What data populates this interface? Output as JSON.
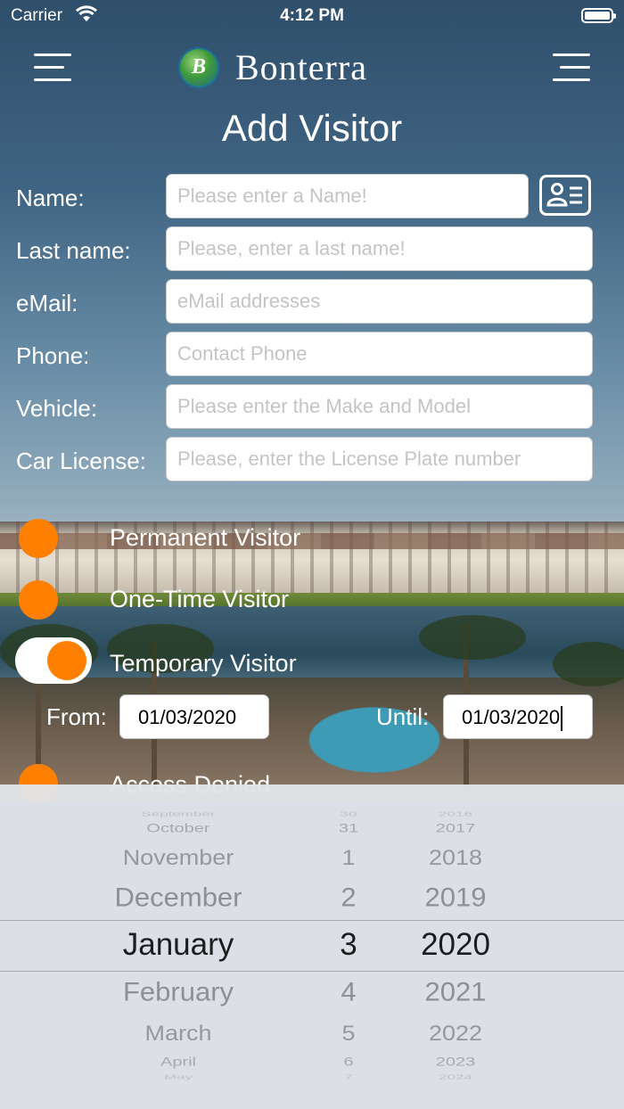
{
  "status_bar": {
    "carrier": "Carrier",
    "time": "4:12 PM"
  },
  "header": {
    "brand": "Bonterra",
    "logo_letter": "B",
    "title": "Add Visitor"
  },
  "form": {
    "fields": [
      {
        "label": "Name:",
        "placeholder": "Please enter a Name!"
      },
      {
        "label": "Last name:",
        "placeholder": "Please, enter a last name!"
      },
      {
        "label": "eMail:",
        "placeholder": "eMail addresses"
      },
      {
        "label": "Phone:",
        "placeholder": "Contact Phone"
      },
      {
        "label": "Vehicle:",
        "placeholder": "Please enter the Make and Model"
      },
      {
        "label": "Car License:",
        "placeholder": "Please, enter the License Plate number"
      }
    ]
  },
  "visitor_types": [
    {
      "label": "Permanent Visitor",
      "selected": false
    },
    {
      "label": "One-Time Visitor",
      "selected": false
    },
    {
      "label": "Temporary Visitor",
      "selected": true
    },
    {
      "label": "Access Denied",
      "selected": false
    }
  ],
  "dates": {
    "from_label": "From:",
    "from_value": "01/03/2020",
    "until_label": "Until:",
    "until_value": "01/03/2020"
  },
  "picker": {
    "months": [
      "September",
      "October",
      "November",
      "December",
      "January",
      "February",
      "March",
      "April",
      "May"
    ],
    "days": [
      "30",
      "31",
      "1",
      "2",
      "3",
      "4",
      "5",
      "6",
      "7"
    ],
    "years": [
      "2016",
      "2017",
      "2018",
      "2019",
      "2020",
      "2021",
      "2022",
      "2023",
      "2024"
    ],
    "selected_index": 4
  },
  "colors": {
    "accent": "#ff8000",
    "field_bg": "#ffffff",
    "picker_bg": "#e2e4e8"
  }
}
